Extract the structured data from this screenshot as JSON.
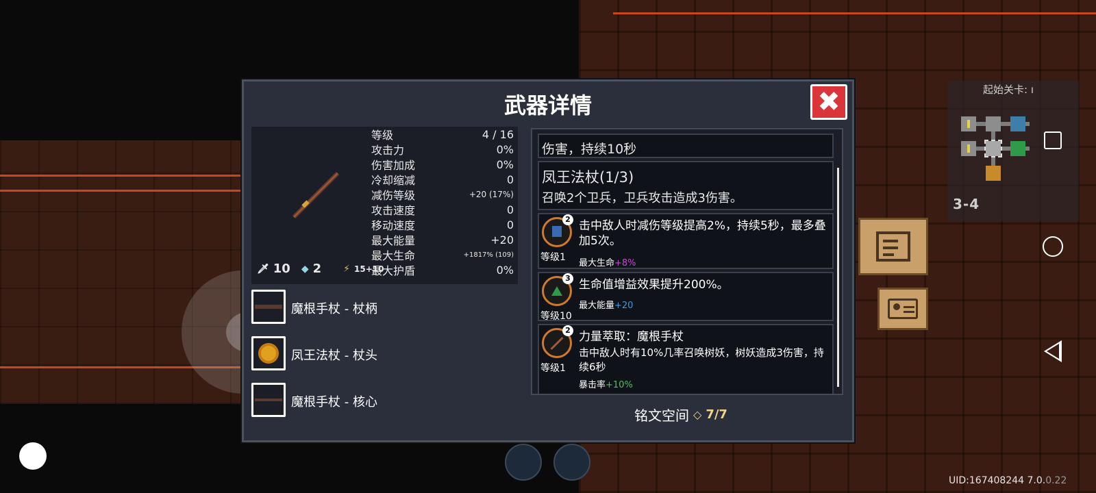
{
  "modal": {
    "title": "武器详情",
    "close_glyph": "✖"
  },
  "stats": [
    {
      "label": "等级",
      "value": "4 / 16"
    },
    {
      "label": "攻击力",
      "value": "0%"
    },
    {
      "label": "伤害加成",
      "value": "0%"
    },
    {
      "label": "冷却缩减",
      "value": "0"
    },
    {
      "label": "减伤等级",
      "value": "+20 (17%)"
    },
    {
      "label": "攻击速度",
      "value": "0"
    },
    {
      "label": "移动速度",
      "value": "0"
    },
    {
      "label": "最大能量",
      "value": "+20"
    },
    {
      "label": "最大生命",
      "value": "+1817% (109)"
    },
    {
      "label": "最大护盾",
      "value": "0%"
    }
  ],
  "bottom_stats": {
    "attack": "10",
    "crystal": "2",
    "energy": "15+10"
  },
  "parts": [
    {
      "label": "魔根手杖 - 杖柄",
      "icon": "staff-handle-icon"
    },
    {
      "label": "凤王法杖 - 杖头",
      "icon": "phoenix-head-icon"
    },
    {
      "label": "魔根手杖 - 核心",
      "icon": "staff-core-icon"
    }
  ],
  "cards": {
    "top_fragment": "伤害，持续10秒",
    "set_title": "凤王法杖(1/3)",
    "set_desc": "召唤2个卫兵，卫兵攻击造成3伤害。",
    "inscriptions": [
      {
        "badge": "2",
        "level": "等级1",
        "text": "击中敌人时减伤等级提高2%，持续5秒，最多叠加5次。",
        "sub_label": "最大生命",
        "sub_value": "+8%",
        "sub_color": "#c846d8"
      },
      {
        "badge": "3",
        "level": "等级10",
        "text": "生命值增益效果提升200%。",
        "sub_label": "最大能量",
        "sub_value": "+20",
        "sub_color": "#3d9be6"
      },
      {
        "badge": "2",
        "level": "等级1",
        "text": "力量萃取：魔根手杖",
        "text2": "击中敌人时有10%几率召唤树妖，树妖造成3伤害，持续6秒",
        "sub_label": "暴击率",
        "sub_value": "+10%",
        "sub_color": "#4cc45a"
      }
    ]
  },
  "rune_space": {
    "label": "铭文空间",
    "count": "7/7"
  },
  "minimap": {
    "label": "起始关卡: ı",
    "stage": "3-4"
  },
  "uid": {
    "text": "UID:167408244 7.0.",
    "dim": "0.22"
  },
  "colors": {
    "close": "#d9353b",
    "accent": "#f1d489",
    "rail": "#c4471f"
  }
}
